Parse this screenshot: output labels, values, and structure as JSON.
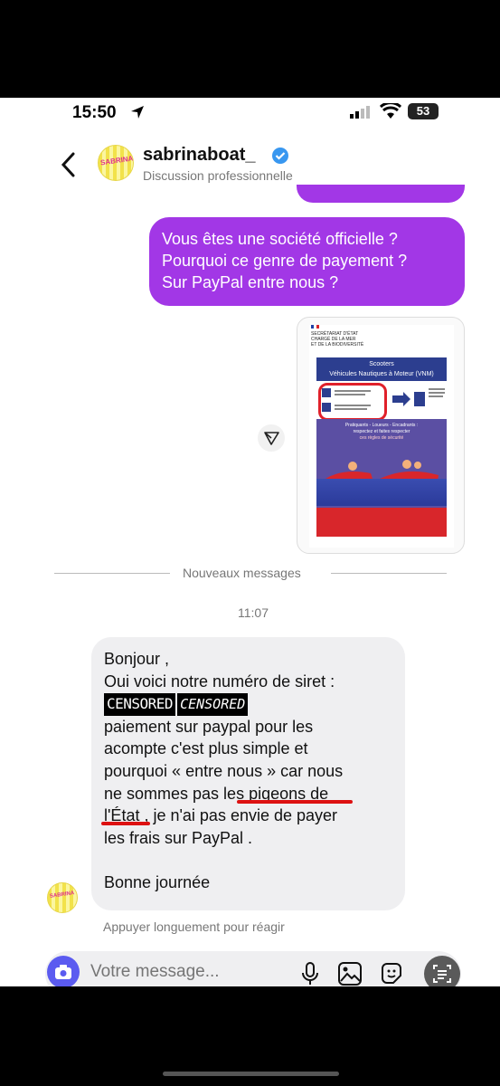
{
  "status_bar": {
    "time": "15:50",
    "battery": "53"
  },
  "header": {
    "username": "sabrinaboat_",
    "subtitle": "Discussion professionnelle",
    "avatar_text": "SABRINA"
  },
  "outgoing_message": {
    "lines": [
      "Vous êtes une société officielle ?",
      "Pourquoi ce genre de payement ?",
      "Sur PayPal entre nous ?"
    ]
  },
  "image_card": {
    "ministry_lines": [
      "SECRÉTARIAT D'ÉTAT",
      "CHARGÉ DE LA MER",
      "ET DE LA BIODIVERSITÉ"
    ],
    "poster_title_lines": [
      "Scooters",
      "Véhicules Nautiques à Moteur (VNM)"
    ],
    "poster_middle_lines": [
      "Pratiquants - Loueurs - Encadrants :",
      "respectez et faites respecter",
      "ces règles de sécurité"
    ]
  },
  "divider_label": "Nouveaux messages",
  "timestamp": "11:07",
  "incoming_message": {
    "line1": "Bonjour ,",
    "line2": "Oui voici notre numéro de siret :",
    "censor1": "CENSORED",
    "censor2": "CENSORED",
    "line4": "paiement sur paypal pour les",
    "line5": "acompte c'est plus simple et",
    "line6": "pourquoi « entre nous » car nous",
    "line7": "ne sommes pas les pigeons de",
    "line8": "l'État , je n'ai pas envie de payer",
    "line9": "les frais sur PayPal .",
    "line10": "Bonne journée"
  },
  "reaction_hint": "Appuyer longuement pour réagir",
  "composer": {
    "placeholder": "Votre message..."
  },
  "colors": {
    "accent": "#a237e6",
    "camera": "#5b5bf0",
    "underline": "#dd1111"
  }
}
